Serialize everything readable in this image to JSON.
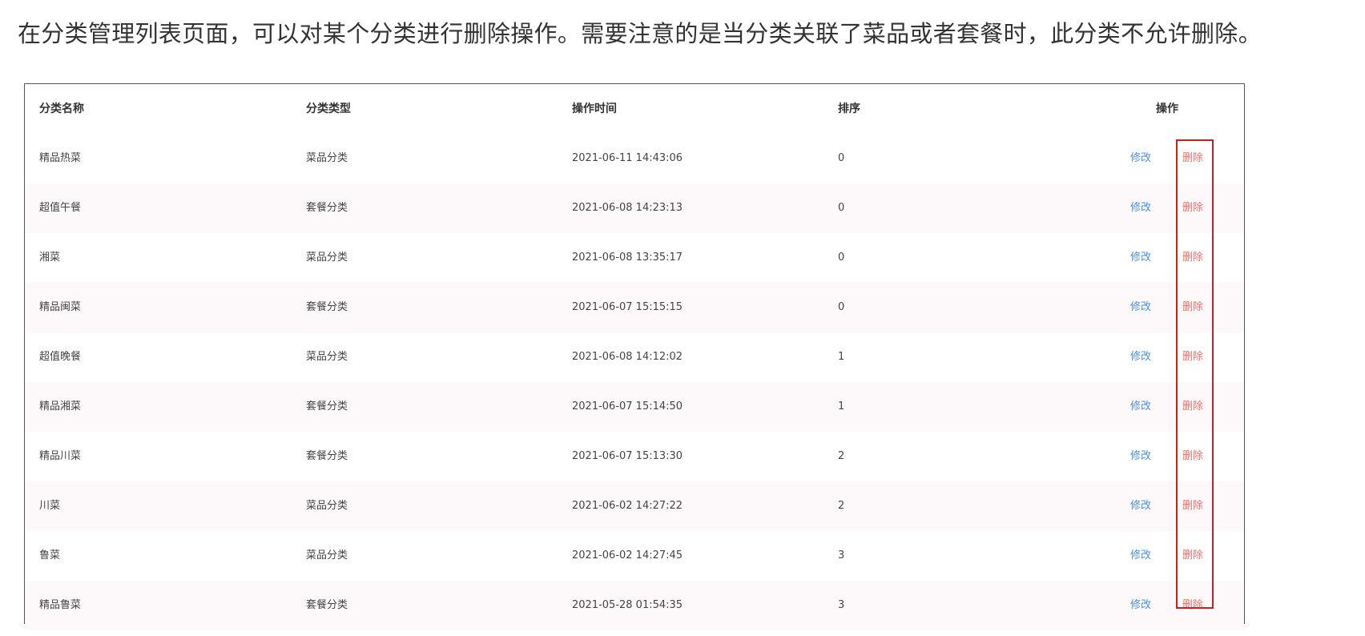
{
  "intro_text": "在分类管理列表页面，可以对某个分类进行删除操作。需要注意的是当分类关联了菜品或者套餐时，此分类不允许删除。",
  "table": {
    "headers": {
      "name": "分类名称",
      "type": "分类类型",
      "time": "操作时间",
      "sort": "排序",
      "ops": "操作"
    },
    "rows": [
      {
        "name": "精品热菜",
        "type": "菜品分类",
        "time": "2021-06-11 14:43:06",
        "sort": "0",
        "edit": "修改",
        "delete": "删除"
      },
      {
        "name": "超值午餐",
        "type": "套餐分类",
        "time": "2021-06-08 14:23:13",
        "sort": "0",
        "edit": "修改",
        "delete": "删除"
      },
      {
        "name": "湘菜",
        "type": "菜品分类",
        "time": "2021-06-08 13:35:17",
        "sort": "0",
        "edit": "修改",
        "delete": "删除"
      },
      {
        "name": "精品闽菜",
        "type": "套餐分类",
        "time": "2021-06-07 15:15:15",
        "sort": "0",
        "edit": "修改",
        "delete": "删除"
      },
      {
        "name": "超值晚餐",
        "type": "菜品分类",
        "time": "2021-06-08 14:12:02",
        "sort": "1",
        "edit": "修改",
        "delete": "删除"
      },
      {
        "name": "精品湘菜",
        "type": "套餐分类",
        "time": "2021-06-07 15:14:50",
        "sort": "1",
        "edit": "修改",
        "delete": "删除"
      },
      {
        "name": "精品川菜",
        "type": "套餐分类",
        "time": "2021-06-07 15:13:30",
        "sort": "2",
        "edit": "修改",
        "delete": "删除"
      },
      {
        "name": "川菜",
        "type": "菜品分类",
        "time": "2021-06-02 14:27:22",
        "sort": "2",
        "edit": "修改",
        "delete": "删除"
      },
      {
        "name": "鲁菜",
        "type": "菜品分类",
        "time": "2021-06-02 14:27:45",
        "sort": "3",
        "edit": "修改",
        "delete": "删除"
      },
      {
        "name": "精品鲁菜",
        "type": "套餐分类",
        "time": "2021-05-28 01:54:35",
        "sort": "3",
        "edit": "修改",
        "delete": "删除"
      }
    ]
  },
  "colors": {
    "edit_link": "#4a8fd8",
    "delete_link": "#e5736a",
    "highlight_box": "#c5221f"
  }
}
